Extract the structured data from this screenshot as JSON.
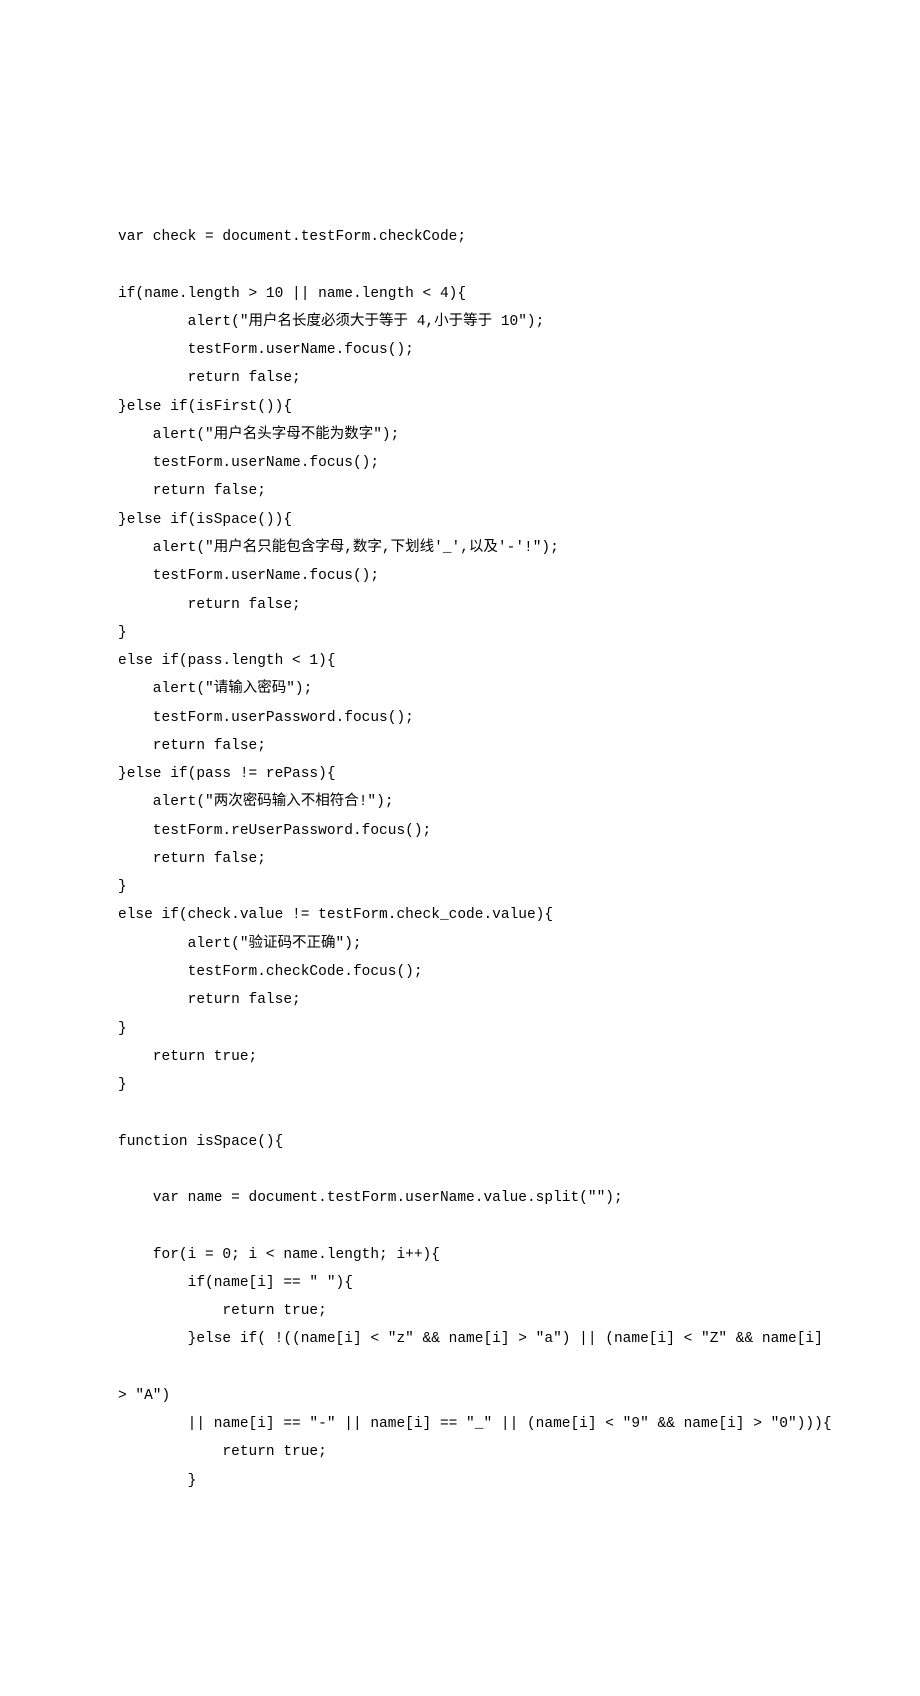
{
  "lines": [
    "var check = document.testForm.checkCode;",
    "",
    "if(name.length > 10 || name.length < 4){",
    "        alert(\"用户名长度必须大于等于 4,小于等于 10\");",
    "        testForm.userName.focus();",
    "        return false;",
    "}else if(isFirst()){",
    "    alert(\"用户名头字母不能为数字\");",
    "    testForm.userName.focus();",
    "    return false;",
    "}else if(isSpace()){",
    "    alert(\"用户名只能包含字母,数字,下划线'_',以及'-'!\");",
    "    testForm.userName.focus();",
    "        return false;",
    "}",
    "else if(pass.length < 1){",
    "    alert(\"请输入密码\");",
    "    testForm.userPassword.focus();",
    "    return false;",
    "}else if(pass != rePass){",
    "    alert(\"两次密码输入不相符合!\");",
    "    testForm.reUserPassword.focus();",
    "    return false;",
    "}",
    "else if(check.value != testForm.check_code.value){",
    "        alert(\"验证码不正确\");",
    "        testForm.checkCode.focus();",
    "        return false;",
    "}",
    "    return true;",
    "}",
    "",
    "function isSpace(){",
    "",
    "    var name = document.testForm.userName.value.split(\"\");",
    "",
    "    for(i = 0; i < name.length; i++){",
    "        if(name[i] == \" \"){",
    "            return true;",
    "        }else if( !((name[i] < \"z\" && name[i] > \"a\") || (name[i] < \"Z\" && name[i]",
    "",
    "        || name[i] == \"-\" || name[i] == \"_\" || (name[i] < \"9\" && name[i] > \"0\"))){",
    "            return true;",
    "        }"
  ],
  "outdented_line": "> \"A\")",
  "outdented_index": 40
}
